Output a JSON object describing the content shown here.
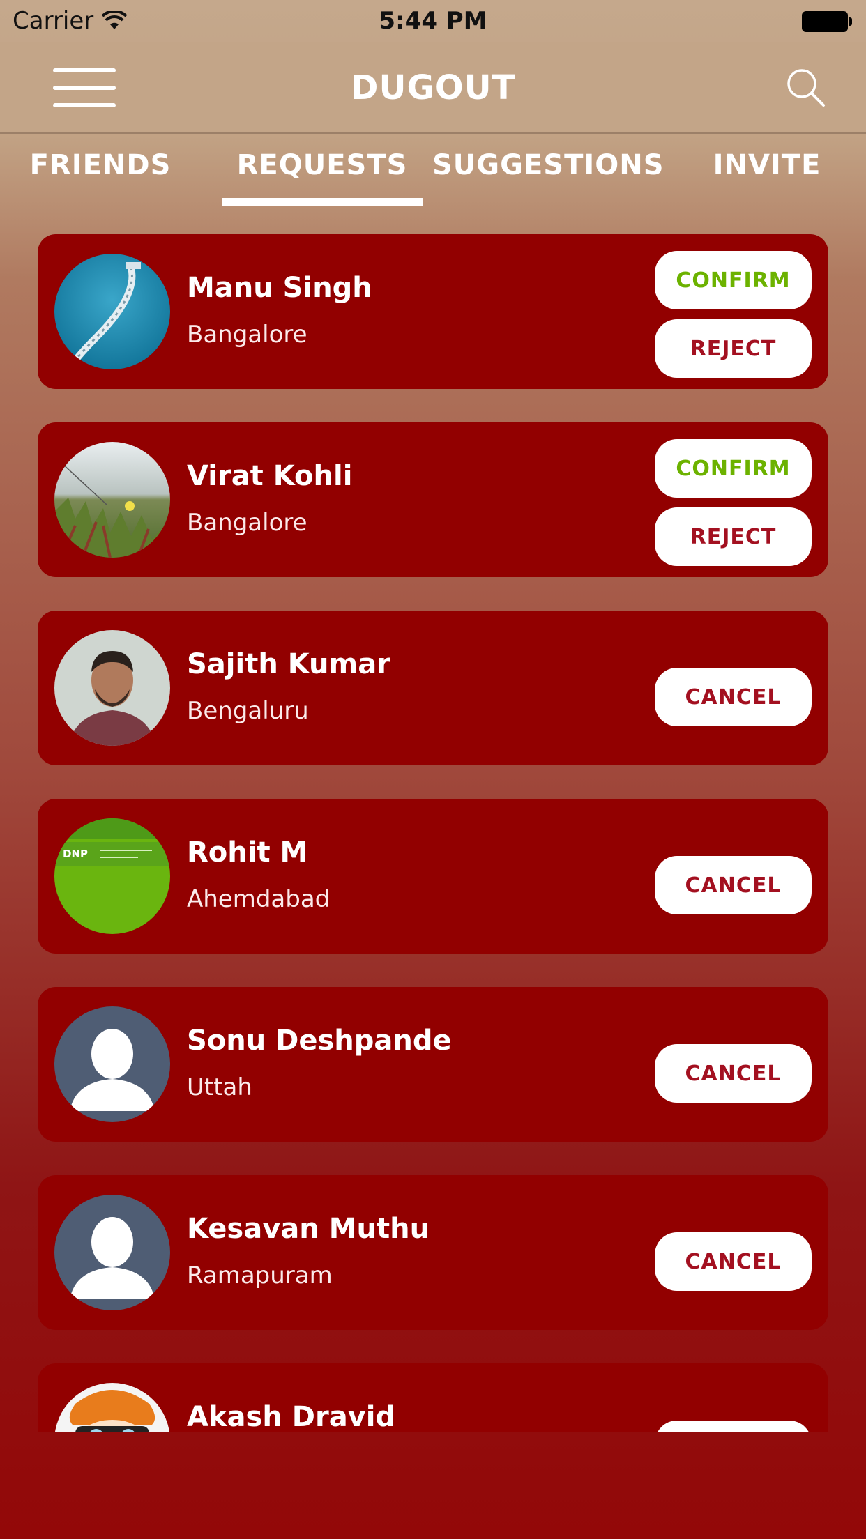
{
  "status_bar": {
    "carrier": "Carrier",
    "time": "5:44 PM"
  },
  "header": {
    "title": "DUGOUT",
    "menu_icon": "hamburger-menu-icon",
    "search_icon": "search-icon"
  },
  "tabs": [
    {
      "label": "FRIENDS",
      "active": false
    },
    {
      "label": "REQUESTS",
      "active": true
    },
    {
      "label": "SUGGESTIONS",
      "active": false
    },
    {
      "label": "INVITE",
      "active": false
    }
  ],
  "colors": {
    "card": "#920000",
    "confirm_text": "#6cb200",
    "reject_text": "#a31020",
    "header": "#c3a588"
  },
  "requests": [
    {
      "name": "Manu Singh",
      "city": "Bangalore",
      "type": "incoming",
      "avatar": "bridge-photo",
      "confirm_label": "CONFIRM",
      "reject_label": "REJECT"
    },
    {
      "name": "Virat Kohli",
      "city": "Bangalore",
      "type": "incoming",
      "avatar": "flower-field-photo",
      "confirm_label": "CONFIRM",
      "reject_label": "REJECT"
    },
    {
      "name": "Sajith Kumar",
      "city": "Bengaluru",
      "type": "sent",
      "avatar": "person-photo",
      "cancel_label": "CANCEL"
    },
    {
      "name": "Rohit M",
      "city": "Ahemdabad",
      "type": "sent",
      "avatar": "green-screenshot",
      "avatar_text": "DNP",
      "cancel_label": "CANCEL"
    },
    {
      "name": "Sonu Deshpande",
      "city": "Uttah",
      "type": "sent",
      "avatar": "default-avatar",
      "cancel_label": "CANCEL"
    },
    {
      "name": "Kesavan Muthu",
      "city": "Ramapuram",
      "type": "sent",
      "avatar": "default-avatar",
      "cancel_label": "CANCEL"
    },
    {
      "name": "Akash Dravid",
      "city": "",
      "type": "sent",
      "avatar": "cartoon-avatar",
      "cancel_label": ""
    }
  ]
}
